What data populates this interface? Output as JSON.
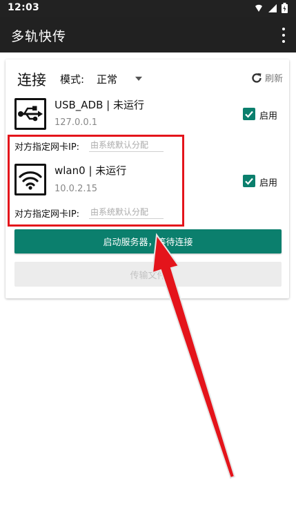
{
  "status_bar": {
    "time": "12:03"
  },
  "app_bar": {
    "title": "多轨快传"
  },
  "card": {
    "heading": "连接",
    "mode_label": "模式:",
    "mode_value": "正常",
    "refresh_label": "刷新",
    "connections": [
      {
        "name": "USB_ADB | 未运行",
        "address": "127.0.0.1",
        "icon": "usb-icon",
        "enable_label": "启用",
        "enabled": true,
        "ip_label": "对方指定网卡IP:",
        "ip_placeholder": "由系统默认分配"
      },
      {
        "name": "wlan0 | 未运行",
        "address": "10.0.2.15",
        "icon": "wifi-icon",
        "enable_label": "启用",
        "enabled": true,
        "ip_label": "对方指定网卡IP:",
        "ip_placeholder": "由系统默认分配"
      }
    ],
    "start_button": "启动服务器，等待连接",
    "transfer_button": "传输文件"
  },
  "colors": {
    "accent": "#0b7f6d",
    "app_bar": "#212121",
    "annotation": "#e4141b"
  }
}
